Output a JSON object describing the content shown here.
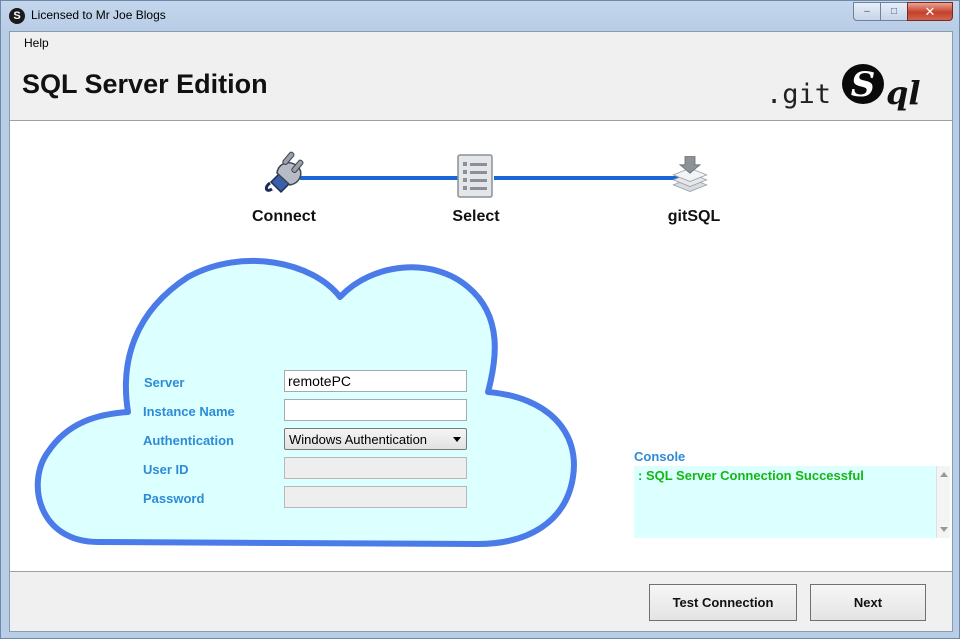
{
  "window": {
    "title": "Licensed to Mr Joe Blogs",
    "app_icon_letter": "S",
    "controls": {
      "minimize": "–",
      "maximize": "□",
      "close": "✕"
    }
  },
  "menu": {
    "help_label": "Help"
  },
  "header": {
    "title": "SQL Server Edition",
    "logo_text_prefix": ".git",
    "logo_badge_letter": "S",
    "logo_text_suffix": "ql"
  },
  "steps": [
    {
      "label": "Connect",
      "icon": "plug-icon"
    },
    {
      "label": "Select",
      "icon": "list-document-icon"
    },
    {
      "label": "gitSQL",
      "icon": "stack-download-icon"
    }
  ],
  "form": {
    "server_label": "Server",
    "server_value": "remotePC",
    "instance_label": "Instance Name",
    "instance_value": "",
    "auth_label": "Authentication",
    "auth_value": "Windows Authentication",
    "userid_label": "User ID",
    "userid_value": "",
    "password_label": "Password",
    "password_value": ""
  },
  "console": {
    "label": "Console",
    "message": ": SQL Server Connection Successful"
  },
  "footer": {
    "test_connection_label": "Test Connection",
    "next_label": "Next"
  },
  "colors": {
    "accent_blue": "#1a66d6",
    "label_blue": "#2e8bd6",
    "cloud_fill": "#dcffff",
    "cloud_stroke": "#4a7be8",
    "success_green": "#14b814"
  }
}
